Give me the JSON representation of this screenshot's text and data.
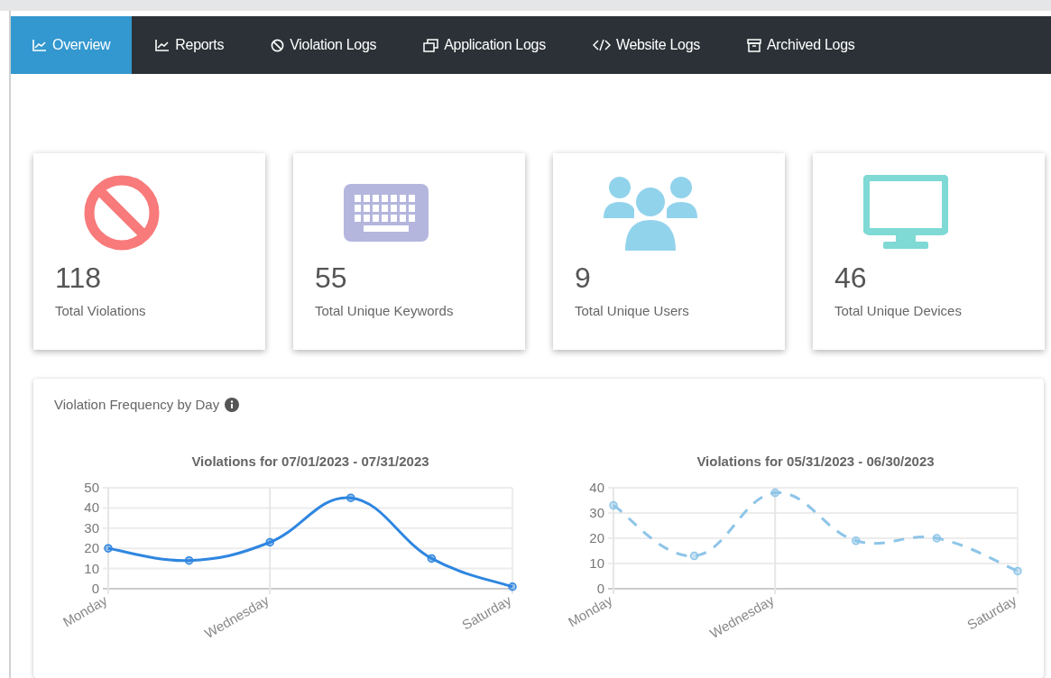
{
  "tabs": [
    {
      "label": "Overview",
      "kind": "chart",
      "selected": true
    },
    {
      "label": "Reports",
      "kind": "chart",
      "selected": false
    },
    {
      "label": "Violation Logs",
      "kind": "ban",
      "selected": false
    },
    {
      "label": "Application Logs",
      "kind": "windows",
      "selected": false
    },
    {
      "label": "Website Logs",
      "kind": "code",
      "selected": false
    },
    {
      "label": "Archived Logs",
      "kind": "archive",
      "selected": false
    }
  ],
  "stat_cards": [
    {
      "kind": "ban",
      "color": "#f87a7a",
      "value": "118",
      "label": "Total Violations"
    },
    {
      "kind": "keyboard",
      "color": "#b4b6de",
      "value": "55",
      "label": "Total Unique Keywords"
    },
    {
      "kind": "users",
      "color": "#92d3ec",
      "value": "9",
      "label": "Total Unique Users"
    },
    {
      "kind": "monitor",
      "color": "#7fd9d4",
      "value": "46",
      "label": "Total Unique Devices"
    }
  ],
  "frequency_panel": {
    "title": "Violation Frequency by Day",
    "charts": [
      {
        "chart_data": {
          "type": "line",
          "title": "Violations for 07/01/2023 - 07/31/2023",
          "categories": [
            "Monday",
            null,
            "Wednesday",
            null,
            null,
            "Saturday"
          ],
          "ylim": [
            0,
            50
          ],
          "yticks": [
            0,
            10,
            20,
            30,
            40,
            50
          ],
          "grid": true,
          "series": [
            {
              "color": "#2f86e0",
              "marker": "circle",
              "values": [
                20,
                14,
                23,
                45,
                15,
                1
              ]
            }
          ]
        }
      },
      {
        "chart_data": {
          "type": "line",
          "title": "Violations for 05/31/2023 - 06/30/2023",
          "categories": [
            "Monday",
            null,
            "Wednesday",
            null,
            null,
            "Saturday"
          ],
          "ylim": [
            0,
            40
          ],
          "yticks": [
            0,
            10,
            20,
            30,
            40
          ],
          "grid": true,
          "series": [
            {
              "color": "#8ec5e8",
              "line_style": "dashed",
              "marker": "circle",
              "values": [
                33,
                13,
                38,
                19,
                20,
                7
              ]
            }
          ]
        }
      }
    ]
  }
}
